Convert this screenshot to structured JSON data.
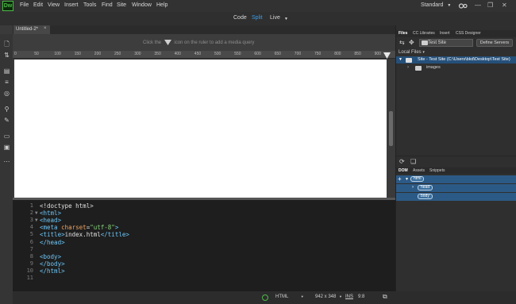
{
  "app": {
    "logo": "Dw"
  },
  "menu": [
    "File",
    "Edit",
    "View",
    "Insert",
    "Tools",
    "Find",
    "Site",
    "Window",
    "Help"
  ],
  "workspace": {
    "label": "Standard",
    "dropdown_icon": "chevron-down-icon"
  },
  "window_controls": {
    "minimize": "—",
    "maximize": "❐",
    "close": "✕"
  },
  "views": {
    "code": "Code",
    "split": "Split",
    "live": "Live"
  },
  "document_tab": {
    "title": "Untitled-2*",
    "close": "×"
  },
  "media_query_hint": {
    "before": "Click the",
    "after": "icon on the ruler to add a media query"
  },
  "ruler_ticks": [
    "0",
    "50",
    "100",
    "150",
    "200",
    "250",
    "300",
    "350",
    "400",
    "450",
    "500",
    "550",
    "600",
    "650",
    "700",
    "750",
    "800",
    "850",
    "900"
  ],
  "code_lines": [
    {
      "num": "1",
      "fold": "",
      "parts": [
        {
          "t": "<!doctype html>",
          "c": "plain"
        }
      ]
    },
    {
      "num": "2",
      "fold": "▼",
      "parts": [
        {
          "t": "<html>",
          "c": "tag"
        }
      ]
    },
    {
      "num": "3",
      "fold": "▼",
      "parts": [
        {
          "t": "<head>",
          "c": "tag"
        }
      ]
    },
    {
      "num": "4",
      "fold": "",
      "parts": [
        {
          "t": "<meta ",
          "c": "tag"
        },
        {
          "t": "charset",
          "c": "attr"
        },
        {
          "t": "=",
          "c": "plain"
        },
        {
          "t": "\"utf-8\"",
          "c": "str"
        },
        {
          "t": ">",
          "c": "tag"
        }
      ]
    },
    {
      "num": "5",
      "fold": "",
      "parts": [
        {
          "t": "<title>",
          "c": "tag"
        },
        {
          "t": "index.html",
          "c": "plain"
        },
        {
          "t": "</title>",
          "c": "tag"
        }
      ]
    },
    {
      "num": "6",
      "fold": "",
      "parts": [
        {
          "t": "</head>",
          "c": "tag"
        }
      ]
    },
    {
      "num": "7",
      "fold": "",
      "parts": []
    },
    {
      "num": "8",
      "fold": "",
      "parts": [
        {
          "t": "<body>",
          "c": "tag"
        }
      ]
    },
    {
      "num": "9",
      "fold": "",
      "parts": [
        {
          "t": "</body>",
          "c": "tag"
        }
      ]
    },
    {
      "num": "10",
      "fold": "",
      "parts": [
        {
          "t": "</html>",
          "c": "tag"
        }
      ]
    },
    {
      "num": "11",
      "fold": "",
      "parts": []
    }
  ],
  "status": {
    "language": "HTML",
    "size": "942 x 348",
    "mode": "INS",
    "position": "9:8"
  },
  "files_panel": {
    "tabs": [
      "Files",
      "CC Libraries",
      "Insert",
      "CSS Designer"
    ],
    "site_select": "Test Site",
    "define_servers": "Define Servers",
    "local_files": "Local Files",
    "site_entry": "Site - Test Site (C:\\Users\\bkd\\Desktop\\Test Site)",
    "folder": "images"
  },
  "dom_panel": {
    "tabs": [
      "DOM",
      "Assets",
      "Snippets"
    ],
    "nodes": [
      "html",
      "head",
      "body"
    ]
  },
  "colors": {
    "accent": "#3b9de6",
    "logo_green": "#4db849",
    "selection": "#25507a"
  }
}
